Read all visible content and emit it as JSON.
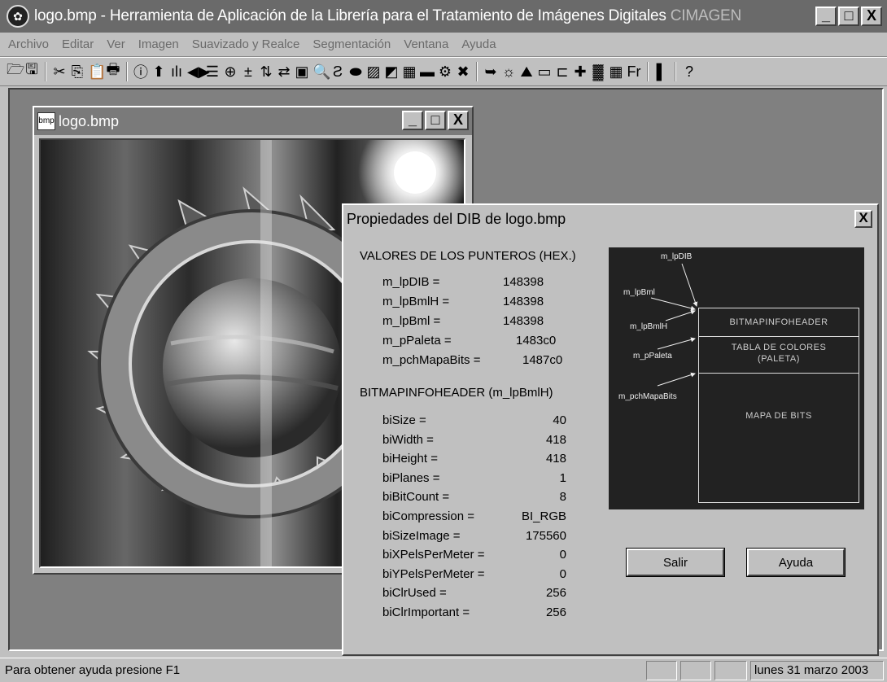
{
  "app": {
    "title_main": "logo.bmp - Herramienta de Aplicación de la Librería para el Tratamiento de Imágenes Digitales ",
    "title_dim": "CIMAGEN",
    "minimize": "_",
    "maximize": "□",
    "close": "X"
  },
  "menu": [
    "Archivo",
    "Editar",
    "Ver",
    "Imagen",
    "Suavizado y Realce",
    "Segmentación",
    "Ventana",
    "Ayuda"
  ],
  "toolbar": {
    "icons": [
      "open-icon",
      "save-icon",
      "sep",
      "cut-icon",
      "copy-icon",
      "paste-icon",
      "print-icon",
      "sep",
      "info-icon",
      "up-arrow-icon",
      "histogram-icon",
      "arrows-icon",
      "lines-icon",
      "and-or-icon",
      "plus-minus-icon",
      "flip-vertical-icon",
      "flip-horizontal-icon",
      "image-icon",
      "zoom-icon",
      "s-icon",
      "ellipse-icon",
      "pattern-icon",
      "shape-icon",
      "grid-icon",
      "bars-icon",
      "gear-icon",
      "cross-icon",
      "sep",
      "export-icon",
      "sun-icon",
      "landscape-icon",
      "frame-icon",
      "bracket-icon",
      "puzzle-icon",
      "noise-icon",
      "table-icon",
      "ft-icon",
      "sep",
      "gradient-icon",
      "sep",
      "help-icon"
    ],
    "glyphs": [
      "🗁",
      "🖫",
      "",
      "✂",
      "⎘",
      "📋",
      "🖶",
      "",
      "ⓘ",
      "⬆",
      "ılı",
      "◀▶",
      "☰",
      "⊕",
      "±",
      "⇅",
      "⇄",
      "▣",
      "🔍",
      "Ƨ",
      "⬬",
      "▨",
      "◩",
      "▦",
      "▬",
      "⚙",
      "✖",
      "",
      "➥",
      "☼",
      "⛰",
      "▭",
      "⊏",
      "✚",
      "▓",
      "▦",
      "Fr",
      "",
      "▌",
      "",
      "?"
    ]
  },
  "child_window": {
    "title": "logo.bmp"
  },
  "dialog": {
    "title": "Propiedades del DIB de logo.bmp",
    "close": "X",
    "pointers_header": "VALORES DE LOS PUNTEROS (HEX.)",
    "pointers": [
      {
        "label": "m_lpDIB =",
        "value": "148398"
      },
      {
        "label": "m_lpBmlH =",
        "value": "148398"
      },
      {
        "label": "m_lpBml =",
        "value": "148398"
      },
      {
        "label": "m_pPaleta =",
        "value": "1483c0"
      },
      {
        "label": "m_pchMapaBits =",
        "value": "1487c0"
      }
    ],
    "header_title": "BITMAPINFOHEADER (m_lpBmlH)",
    "header_fields": [
      {
        "label": "biSize =",
        "value": "40"
      },
      {
        "label": "biWidth =",
        "value": "418"
      },
      {
        "label": "biHeight =",
        "value": "418"
      },
      {
        "label": "biPlanes =",
        "value": "1"
      },
      {
        "label": "biBitCount =",
        "value": "8"
      },
      {
        "label": "biCompression =",
        "value": "BI_RGB"
      },
      {
        "label": "biSizeImage =",
        "value": "175560"
      },
      {
        "label": "biXPelsPerMeter =",
        "value": "0"
      },
      {
        "label": "biYPelsPerMeter =",
        "value": "0"
      },
      {
        "label": "biClrUsed =",
        "value": "256"
      },
      {
        "label": "biClrImportant =",
        "value": "256"
      }
    ],
    "diagram": {
      "labels": [
        "m_lpDIB",
        "m_lpBml",
        "m_lpBmlH",
        "m_pPaleta",
        "m_pchMapaBits"
      ],
      "box_header": "BITMAPINFOHEADER",
      "box_palette_1": "TABLA DE COLORES",
      "box_palette_2": "(PALETA)",
      "box_bits": "MAPA DE BITS"
    },
    "exit_button": "Salir",
    "help_button": "Ayuda"
  },
  "status": {
    "text": "Para obtener ayuda presione F1",
    "date": "lunes 31 marzo 2003"
  }
}
